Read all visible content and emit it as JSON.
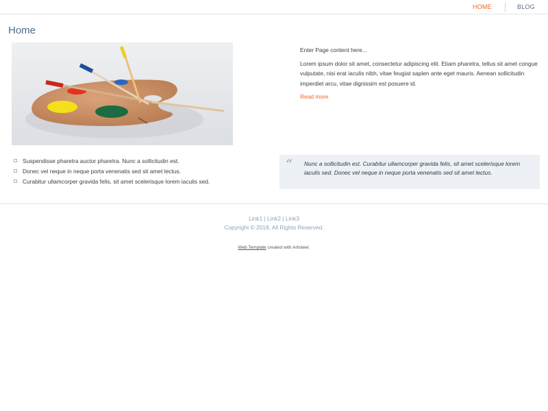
{
  "nav": {
    "home": "HOME",
    "blog": "BLOG"
  },
  "page": {
    "title": "Home"
  },
  "content": {
    "intro": "Enter Page content here...",
    "body": "Lorem ipsum dolor sit amet, consectetur adipiscing elit. Etiam pharetra, tellus sit amet congue vulputate, nisi erat iaculis nibh, vitae feugiat sapien ante eget mauris. Aenean sollicitudin imperdiet arcu, vitae dignissim est posuere id.",
    "read_more": "Read more"
  },
  "bullets": [
    "Suspendisse pharetra auctor pharetra. Nunc a sollicitudin est.",
    "Donec vel neque in neque porta venenatis sed sit amet lectus.",
    "Curabitur ullamcorper gravida felis, sit amet scelerisque lorem iaculis sed."
  ],
  "quote": {
    "mark": "“",
    "text": "Nunc a sollicitudin est. Curabitur ullamcorper gravida felis, sit amet scelerisque lorem iaculis sed. Donec vel neque in neque porta venenatis sed sit amet lectus."
  },
  "footer": {
    "links": [
      "Link1",
      "Link2",
      "Link3"
    ],
    "separator": "|",
    "copyright": "Copyright © 2018. All Rights Reserved.",
    "credit_link": "Web Template",
    "credit_text": "created with Artisteer."
  },
  "colors": {
    "accent": "#e8652e",
    "title": "#4e6c8a",
    "footer_text": "#8fa2b8",
    "quote_bg": "#edf0f4"
  },
  "image": {
    "subject": "painter's palette with brushes"
  }
}
